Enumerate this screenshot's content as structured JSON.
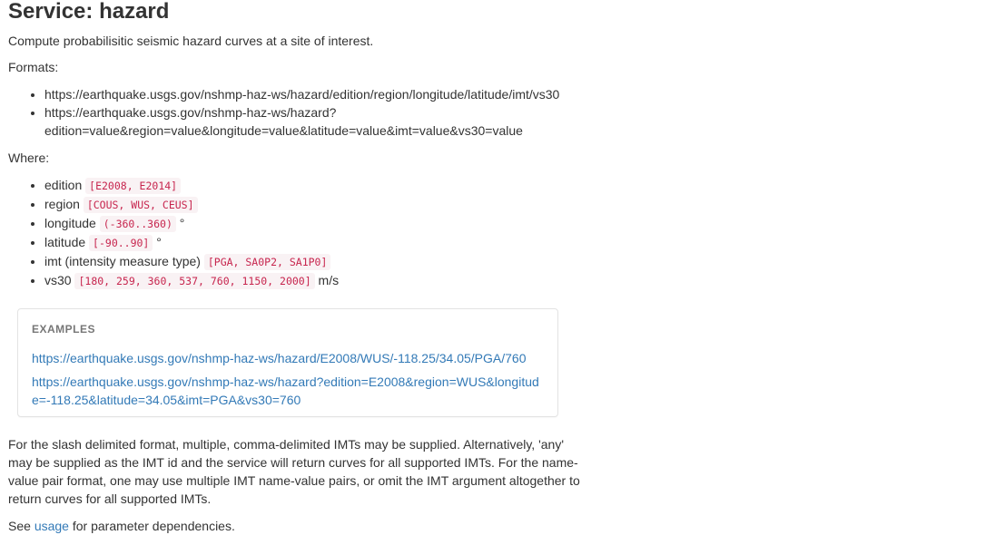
{
  "title": "Service: hazard",
  "description": "Compute probabilisitic seismic hazard curves at a site of interest.",
  "formats_label": "Formats:",
  "formats": [
    "https://earthquake.usgs.gov/nshmp-haz-ws/hazard/edition/region/longitude/latitude/imt/vs30",
    "https://earthquake.usgs.gov/nshmp-haz-ws/hazard?",
    "edition=value&region=value&longitude=value&latitude=value&imt=value&vs30=value"
  ],
  "where_label": "Where:",
  "params": [
    {
      "name": "edition",
      "values": "[E2008, E2014]",
      "unit": ""
    },
    {
      "name": "region",
      "values": "[COUS, WUS, CEUS]",
      "unit": ""
    },
    {
      "name": "longitude",
      "values": "(-360..360)",
      "unit": "°"
    },
    {
      "name": "latitude",
      "values": "[-90..90]",
      "unit": "°"
    },
    {
      "name": "imt (intensity measure type)",
      "values": "[PGA, SA0P2, SA1P0]",
      "unit": ""
    },
    {
      "name": "vs30",
      "values": "[180, 259, 360, 537, 760, 1150, 2000]",
      "unit": "m/s"
    }
  ],
  "examples": {
    "title": "EXAMPLES",
    "links": [
      "https://earthquake.usgs.gov/nshmp-haz-ws/hazard/E2008/WUS/-118.25/34.05/PGA/760",
      "https://earthquake.usgs.gov/nshmp-haz-ws/hazard?edition=E2008&region=WUS&longitude=-118.25&latitude=34.05&imt=PGA&vs30=760"
    ]
  },
  "body_text": "For the slash delimited format, multiple, comma-delimited IMTs may be supplied. Alternatively, 'any' may be supplied as the IMT id and the service will return curves for all supported IMTs. For the name-value pair format, one may use multiple IMT name-value pairs, or omit the IMT argument altogether to return curves for all supported IMTs.",
  "see": {
    "prefix": "See",
    "link": "usage",
    "suffix": "for parameter dependencies."
  }
}
